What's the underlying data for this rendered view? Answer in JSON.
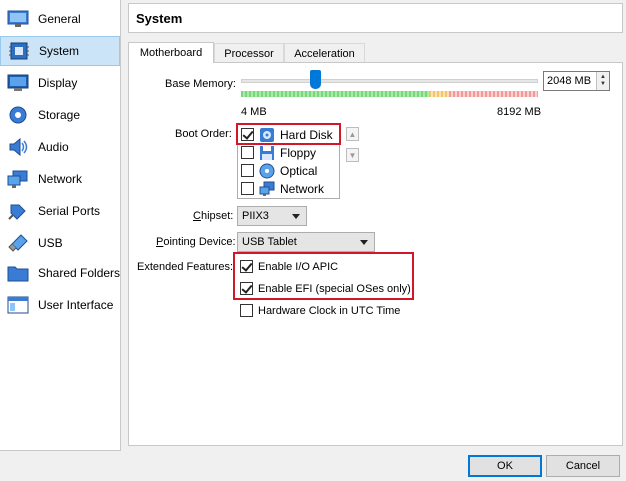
{
  "sidebar": {
    "items": [
      {
        "label": "General",
        "icon": "monitor-icon"
      },
      {
        "label": "System",
        "icon": "chip-icon",
        "selected": true
      },
      {
        "label": "Display",
        "icon": "display-icon"
      },
      {
        "label": "Storage",
        "icon": "disk-icon"
      },
      {
        "label": "Audio",
        "icon": "speaker-icon"
      },
      {
        "label": "Network",
        "icon": "network-icon"
      },
      {
        "label": "Serial Ports",
        "icon": "serial-plug-icon"
      },
      {
        "label": "USB",
        "icon": "usb-icon"
      },
      {
        "label": "Shared Folders",
        "icon": "folder-icon"
      },
      {
        "label": "User Interface",
        "icon": "window-icon"
      }
    ]
  },
  "header": {
    "title": "System"
  },
  "tabs": [
    {
      "label": "Motherboard",
      "active": true
    },
    {
      "label": "Processor"
    },
    {
      "label": "Acceleration"
    }
  ],
  "motherboard": {
    "base_memory": {
      "label": "Base Memory:",
      "value": "2048 MB",
      "min_label": "4 MB",
      "max_label": "8192 MB",
      "fraction": 0.25
    },
    "boot_order": {
      "label": "Boot Order:",
      "items": [
        {
          "label": "Hard Disk",
          "checked": true,
          "icon": "hard-disk-icon"
        },
        {
          "label": "Floppy",
          "checked": false,
          "icon": "floppy-icon"
        },
        {
          "label": "Optical",
          "checked": false,
          "icon": "optical-disc-icon"
        },
        {
          "label": "Network",
          "checked": false,
          "icon": "network-icon"
        }
      ]
    },
    "chipset": {
      "label": "Chipset:",
      "value": "PIIX3"
    },
    "pointing_device": {
      "label": "Pointing Device:",
      "value": "USB Tablet"
    },
    "extended_features": {
      "label": "Extended Features:",
      "io_apic": {
        "label": "Enable I/O APIC",
        "checked": true
      },
      "efi": {
        "label": "Enable EFI (special OSes only)",
        "checked": true
      },
      "utc": {
        "label": "Hardware Clock in UTC Time",
        "checked": false
      }
    }
  },
  "footer": {
    "ok_label": "OK",
    "cancel_label": "Cancel"
  },
  "colors": {
    "accent": "#0078d7",
    "highlight_box": "#d1182b",
    "selected_bg": "#cce4f7"
  }
}
